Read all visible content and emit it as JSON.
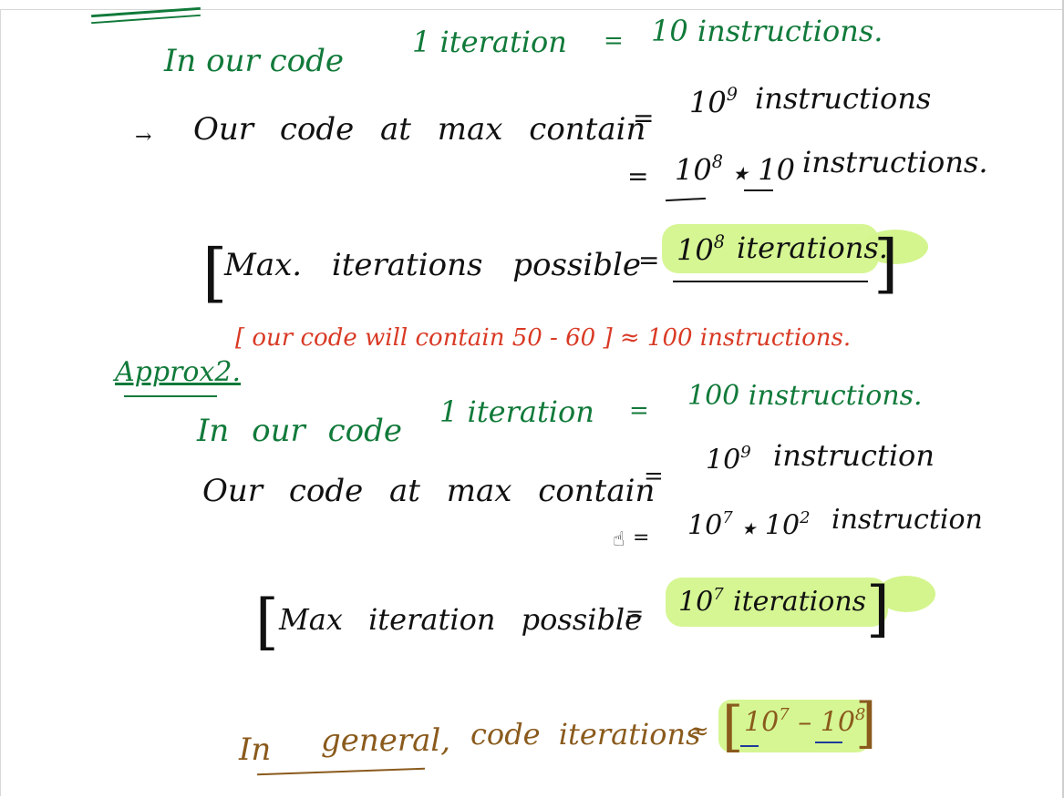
{
  "approach1": {
    "code_iteration": {
      "lhs": "In our code",
      "mid": "1 iteration",
      "eq": "=",
      "rhs": "10 instructions."
    },
    "max_contain": {
      "arrow": "→",
      "lhs": "Our code at max contain",
      "eq": "=",
      "base": "10",
      "exp": "9",
      "unit": "instructions"
    },
    "split": {
      "eq": "=",
      "base": "10",
      "exp": "8",
      "times": "★",
      "factor": "10",
      "unit": "instructions."
    },
    "result": {
      "open": "[",
      "lhs": "Max. iterations possible",
      "eq": "=",
      "base": "10",
      "exp": "8",
      "unit": "iterations.",
      "close": "]"
    }
  },
  "approach2": {
    "label": "Approx2.",
    "note": "[ our code will contain 50 - 60 ] ≈ 100 instructions.",
    "code_iteration": {
      "lhs": "In our code",
      "mid": "1 iteration",
      "eq": "=",
      "rhs": "100 instructions."
    },
    "max_contain": {
      "lhs": "Our code at max contain",
      "eq": "=",
      "base": "10",
      "exp": "9",
      "unit": "instruction"
    },
    "split": {
      "eq": "=",
      "base1": "10",
      "exp1": "7",
      "times": "★",
      "base2": "10",
      "exp2": "2",
      "unit": "instruction"
    },
    "result": {
      "open": "[",
      "lhs": "Max iteration possible",
      "eq": "=",
      "base": "10",
      "exp": "7",
      "unit": "iterations",
      "close": "]"
    }
  },
  "general": {
    "lhs_in": "In",
    "lhs_general": "general,",
    "mid": "code iterations",
    "approx": "≈",
    "open": "[",
    "base1": "10",
    "exp1": "7",
    "dash": "–",
    "base2": "10",
    "exp2": "8",
    "close": "]"
  },
  "colors": {
    "green": "#117a3a",
    "black": "#111111",
    "red": "#d93a25",
    "brown": "#8a5a1c",
    "highlight": "#d4f58e"
  },
  "icons": {
    "cursor": "hand-pointer-icon"
  }
}
